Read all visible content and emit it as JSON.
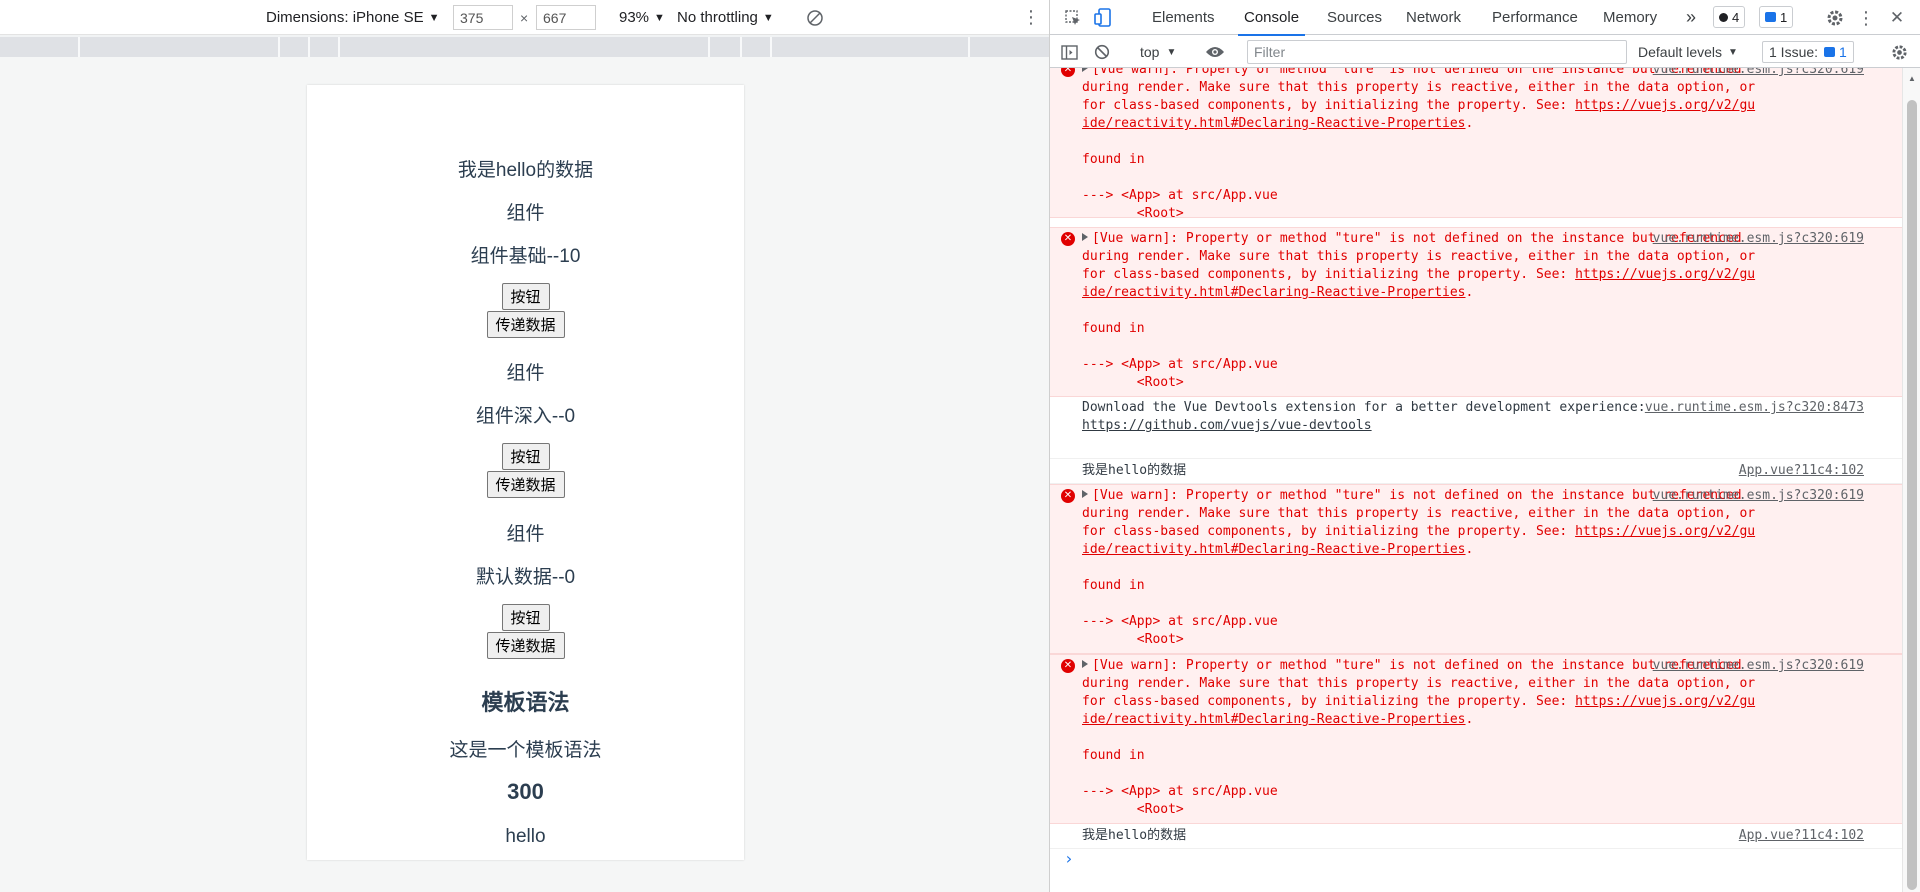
{
  "device_toolbar": {
    "dimensions_label": "Dimensions: iPhone SE",
    "width": "375",
    "times": "×",
    "height": "667",
    "zoom": "93%",
    "throttling": "No throttling"
  },
  "page": {
    "items": [
      {
        "kind": "text",
        "text": "我是hello的数据"
      },
      {
        "kind": "text",
        "text": "组件"
      },
      {
        "kind": "text",
        "text": "组件基础--10"
      },
      {
        "kind": "button",
        "text": "按钮"
      },
      {
        "kind": "button",
        "text": "传递数据"
      },
      {
        "kind": "text",
        "text": "组件"
      },
      {
        "kind": "text",
        "text": "组件深入--0"
      },
      {
        "kind": "button",
        "text": "按钮"
      },
      {
        "kind": "button",
        "text": "传递数据"
      },
      {
        "kind": "text",
        "text": "组件"
      },
      {
        "kind": "text",
        "text": "默认数据--0"
      },
      {
        "kind": "button",
        "text": "按钮"
      },
      {
        "kind": "button",
        "text": "传递数据"
      },
      {
        "kind": "heading",
        "text": "模板语法"
      },
      {
        "kind": "text",
        "text": "这是一个模板语法"
      },
      {
        "kind": "heading",
        "text": "300"
      },
      {
        "kind": "text",
        "text": "hello"
      }
    ]
  },
  "devtools": {
    "tabs": [
      "Elements",
      "Console",
      "Sources",
      "Network",
      "Performance",
      "Memory"
    ],
    "active_tab": "Console",
    "more_tabs": "»",
    "error_count": "4",
    "message_count": "1",
    "console_toolbar": {
      "context": "top",
      "filter_placeholder": "Filter",
      "levels": "Default levels",
      "issues": "1 Issue:",
      "issues_count": "1"
    },
    "messages": [
      {
        "type": "error",
        "text": "[Vue warn]: Property or method \"ture\" is not defined on the instance but referenced during render. Make sure that this property is reactive, either in the data option, or for class-based components, by initializing the property. See: ",
        "link": "https://vuejs.org/v2/guide/reactivity.html#Declaring-Reactive-Properties",
        "tail": ".\n\nfound in\n\n---> <App> at src/App.vue\n       <Root>",
        "source": "vue.runtime.esm.js?c320:619"
      },
      {
        "type": "error",
        "text": "[Vue warn]: Property or method \"ture\" is not defined on the instance but referenced during render. Make sure that this property is reactive, either in the data option, or for class-based components, by initializing the property. See: ",
        "link": "https://vuejs.org/v2/guide/reactivity.html#Declaring-Reactive-Properties",
        "tail": ".\n\nfound in\n\n---> <App> at src/App.vue\n       <Root>",
        "source": "vue.runtime.esm.js?c320:619"
      },
      {
        "type": "info",
        "text": "Download the Vue Devtools extension for a better development experience:\n",
        "link": "https://github.com/vuejs/vue-devtools",
        "tail": "",
        "source": "vue.runtime.esm.js?c320:8473"
      },
      {
        "type": "info",
        "text": "我是hello的数据",
        "link": "",
        "tail": "",
        "source": "App.vue?11c4:102"
      },
      {
        "type": "error",
        "text": "[Vue warn]: Property or method \"ture\" is not defined on the instance but referenced during render. Make sure that this property is reactive, either in the data option, or for class-based components, by initializing the property. See: ",
        "link": "https://vuejs.org/v2/guide/reactivity.html#Declaring-Reactive-Properties",
        "tail": ".\n\nfound in\n\n---> <App> at src/App.vue\n       <Root>",
        "source": "vue.runtime.esm.js?c320:619"
      },
      {
        "type": "error",
        "text": "[Vue warn]: Property or method \"ture\" is not defined on the instance but referenced during render. Make sure that this property is reactive, either in the data option, or for class-based components, by initializing the property. See: ",
        "link": "https://vuejs.org/v2/guide/reactivity.html#Declaring-Reactive-Properties",
        "tail": ".\n\nfound in\n\n---> <App> at src/App.vue\n       <Root>",
        "source": "vue.runtime.esm.js?c320:619"
      },
      {
        "type": "info",
        "text": "我是hello的数据",
        "link": "",
        "tail": "",
        "source": "App.vue?11c4:102"
      }
    ],
    "prompt": "›"
  },
  "colors": {
    "accent": "#1a73e8",
    "error": "#e00000",
    "error_bg": "#fff0f0"
  }
}
